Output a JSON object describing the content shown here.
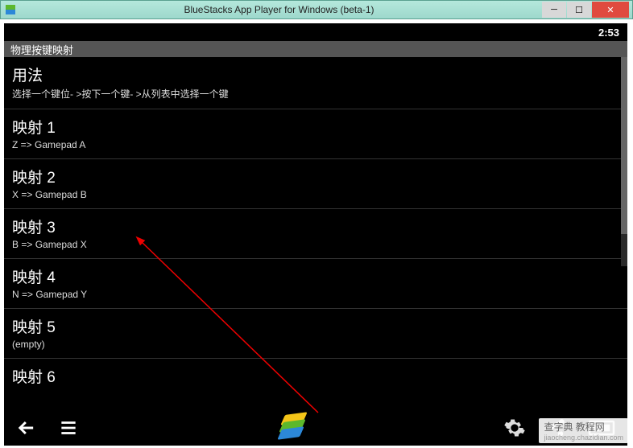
{
  "window": {
    "title": "BlueStacks App Player for Windows (beta-1)"
  },
  "statusbar": {
    "time": "2:53"
  },
  "section_header": "物理按键映射",
  "usage": {
    "title": "用法",
    "subtitle": "选择一个键位- >按下一个键- >从列表中选择一个键"
  },
  "mappings": [
    {
      "title": "映射 1",
      "subtitle": "Z => Gamepad A"
    },
    {
      "title": "映射 2",
      "subtitle": "X => Gamepad B"
    },
    {
      "title": "映射 3",
      "subtitle": "B => Gamepad X"
    },
    {
      "title": "映射 4",
      "subtitle": "N => Gamepad Y"
    },
    {
      "title": "映射 5",
      "subtitle": "(empty)"
    },
    {
      "title": "映射 6",
      "subtitle": ""
    }
  ],
  "watermark": {
    "text": "查字典 教程网",
    "url": "jiaocheng.chazidian.com"
  }
}
